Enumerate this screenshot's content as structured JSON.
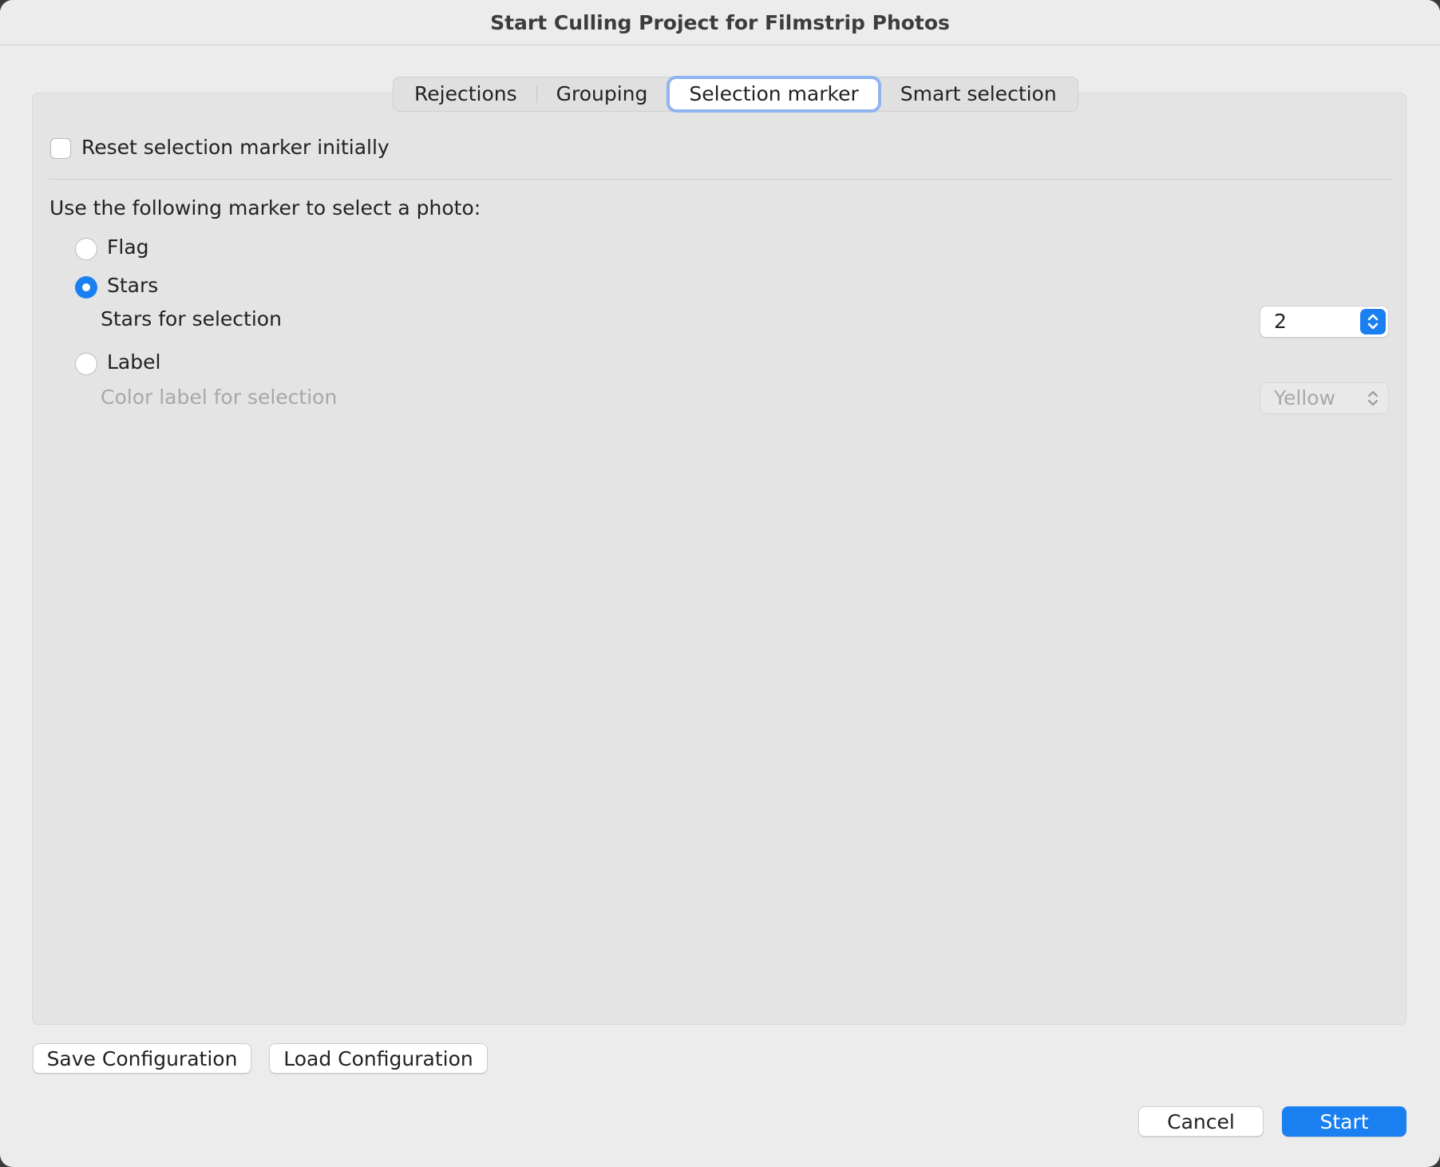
{
  "window": {
    "title": "Start Culling Project for Filmstrip Photos"
  },
  "tabs": [
    {
      "label": "Rejections",
      "active": false
    },
    {
      "label": "Grouping",
      "active": false
    },
    {
      "label": "Selection marker",
      "active": true
    },
    {
      "label": "Smart selection",
      "active": false
    }
  ],
  "reset_checkbox": {
    "label": "Reset selection marker initially",
    "checked": false
  },
  "marker": {
    "prompt": "Use the following marker to select a photo:",
    "options": [
      {
        "label": "Flag",
        "selected": false
      },
      {
        "label": "Stars",
        "selected": true
      },
      {
        "label": "Label",
        "selected": false
      }
    ],
    "stars_for_selection": {
      "label": "Stars for selection",
      "value": "2"
    },
    "color_label": {
      "label": "Color label for selection",
      "value": "Yellow",
      "enabled": false
    }
  },
  "footer": {
    "save_label": "Save Configuration",
    "load_label": "Load Configuration",
    "cancel_label": "Cancel",
    "start_label": "Start"
  },
  "colors": {
    "accent": "#1a7ff0",
    "window_bg": "#ececec",
    "panel_bg": "#e4e4e4",
    "focus_ring": "#8fb4ef"
  },
  "icons": {
    "stepper": "up-down-chevron-icon"
  }
}
